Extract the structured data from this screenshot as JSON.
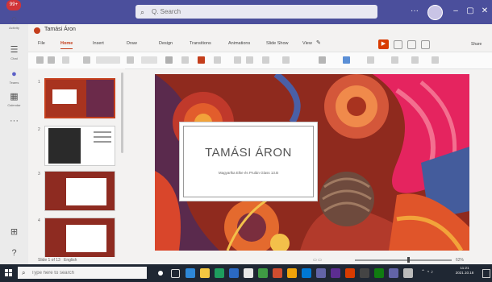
{
  "app": {
    "search_placeholder": "Q. Search",
    "file_title": "Tamási Áron",
    "rail_badge": "99+"
  },
  "rail": [
    {
      "label": "Activity"
    },
    {
      "label": "Chat"
    },
    {
      "label": "Teams"
    },
    {
      "label": "Calendar"
    }
  ],
  "ribbon": {
    "tabs": [
      "File",
      "Home",
      "Insert",
      "Draw",
      "Design",
      "Transitions",
      "Animations",
      "Slide Show",
      "View"
    ],
    "active_tab": "Home",
    "share_label": "Share"
  },
  "slides": {
    "numbers": [
      "1",
      "2",
      "3",
      "4"
    ],
    "selected": 1,
    "counter": "Slide 1 of 13",
    "status": "English"
  },
  "slide": {
    "title": "TAMÁSI ÁRON",
    "subtitle": "Magyarlka Elke és Prulán Glass 13.B"
  },
  "statusbar": {
    "zoom": "62%"
  },
  "taskbar": {
    "search_placeholder": "Type here to search",
    "time": "11:21",
    "date": "2021.10.18"
  }
}
